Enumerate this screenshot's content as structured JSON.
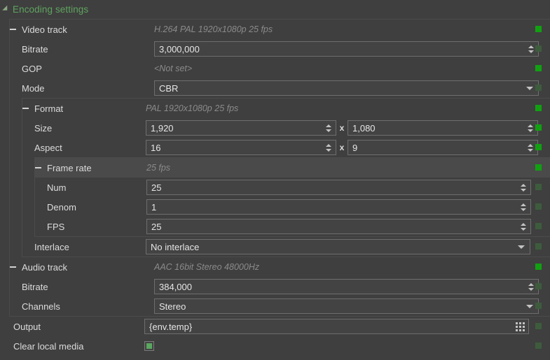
{
  "panel": {
    "title": "Encoding settings",
    "collapse_icon": "triangle-collapse-icon"
  },
  "colors": {
    "background": "#3f3f3f",
    "title_green": "#5fa35f",
    "status_on": "#12a012",
    "status_off": "#3d5c3d",
    "checkbox_green": "#5aa75f",
    "field_border": "#6e6e6e",
    "group_border": "#4b4b4b",
    "highlight_row": "#4a4a4a"
  },
  "rows": {
    "video_track": {
      "label": "Video track",
      "summary": "H.264 PAL 1920x1080p 25 fps",
      "status": "on"
    },
    "bitrate_video": {
      "label": "Bitrate",
      "value": "3,000,000",
      "status": "off"
    },
    "gop": {
      "label": "GOP",
      "summary": "<Not set>",
      "status": "on"
    },
    "mode": {
      "label": "Mode",
      "value": "CBR",
      "options": [
        "CBR"
      ],
      "status": "off"
    },
    "format": {
      "label": "Format",
      "summary": "PAL 1920x1080p 25 fps",
      "status": "on"
    },
    "size": {
      "label": "Size",
      "width_value": "1,920",
      "separator": "x",
      "height_value": "1,080",
      "status": "on"
    },
    "aspect": {
      "label": "Aspect",
      "num_value": "16",
      "separator": "x",
      "den_value": "9",
      "status": "on"
    },
    "frame_rate": {
      "label": "Frame rate",
      "summary": "25 fps",
      "status": "on"
    },
    "num": {
      "label": "Num",
      "value": "25",
      "status": "off"
    },
    "denom": {
      "label": "Denom",
      "value": "1",
      "status": "off"
    },
    "fps": {
      "label": "FPS",
      "value": "25",
      "status": "off"
    },
    "interlace": {
      "label": "Interlace",
      "value": "No interlace",
      "options": [
        "No interlace"
      ],
      "status": "off"
    },
    "audio_track": {
      "label": "Audio track",
      "summary": "AAC 16bit Stereo 48000Hz",
      "status": "on"
    },
    "bitrate_audio": {
      "label": "Bitrate",
      "value": "384,000",
      "status": "off"
    },
    "channels": {
      "label": "Channels",
      "value": "Stereo",
      "options": [
        "Stereo"
      ],
      "status": "off"
    },
    "output": {
      "label": "Output",
      "value": "{env.temp}",
      "browse_icon": "dot-grid-icon",
      "status": "off"
    },
    "clear_local_media": {
      "label": "Clear local media",
      "checked": true,
      "status": "off"
    }
  }
}
